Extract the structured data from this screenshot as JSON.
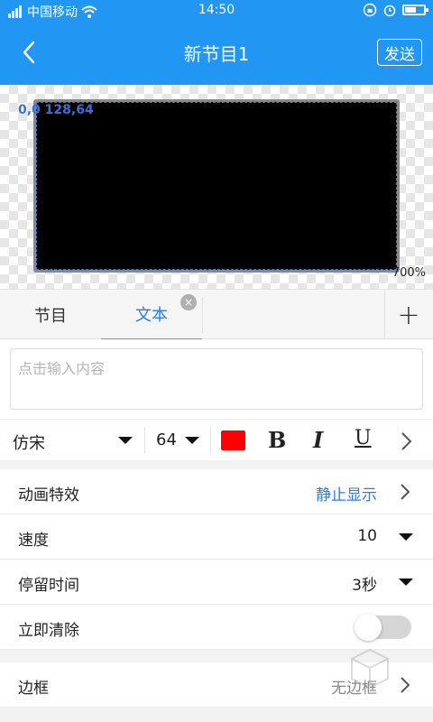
{
  "status_bar": {
    "carrier": "中国移动",
    "time": "14:50",
    "battery_level": 0.6
  },
  "header": {
    "title": "新节目1",
    "send_label": "发送",
    "back_icon": "chevron-left-icon"
  },
  "preview": {
    "coords_label": "0,0 128,64",
    "zoom_label": "700%"
  },
  "tabs": {
    "items": [
      {
        "label": "节目"
      },
      {
        "label": "文本"
      }
    ],
    "active": "文本",
    "close_glyph": "×",
    "add_glyph": "+"
  },
  "text_input": {
    "placeholder": "点击输入内容",
    "value": ""
  },
  "toolbar": {
    "font": "仿宋",
    "size": "64",
    "color": "#ff0000",
    "bold": "B",
    "italic": "I",
    "underline": "U"
  },
  "settings": {
    "animation": {
      "label": "动画特效",
      "value": "静止显示",
      "value_color": "#2a7be4"
    },
    "speed": {
      "label": "速度",
      "value": "10"
    },
    "stay_time": {
      "label": "停留时间",
      "value": "3秒"
    },
    "clear_now": {
      "label": "立即清除",
      "on": false
    },
    "border": {
      "label": "边框",
      "value": "无边框",
      "value_color": "#888888"
    }
  },
  "colors": {
    "accent": "#2196F3",
    "active_tab": "#2a7be4"
  }
}
